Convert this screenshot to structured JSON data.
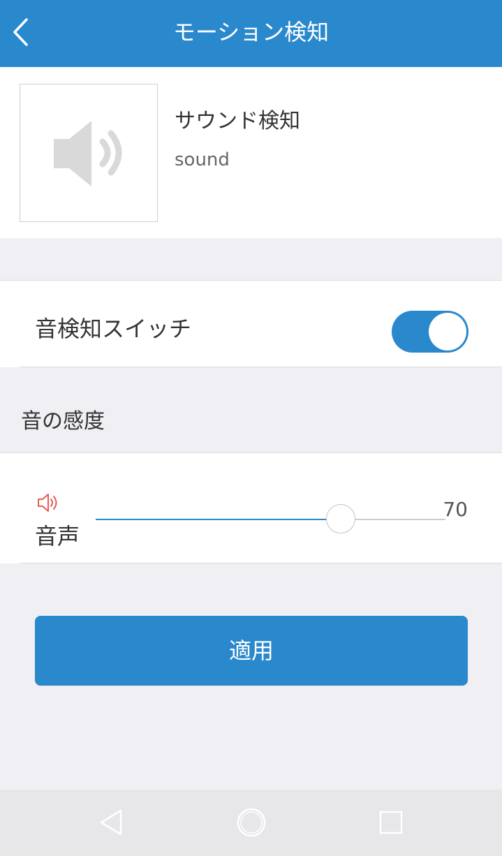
{
  "header": {
    "title": "モーション検知"
  },
  "info": {
    "title": "サウンド検知",
    "subtitle": "sound"
  },
  "switch_row": {
    "label": "音検知スイッチ",
    "enabled": true
  },
  "sensitivity": {
    "section_label": "音の感度",
    "slider_label": "音声",
    "value": "70",
    "max": 100
  },
  "apply_button": {
    "label": "適用"
  },
  "colors": {
    "accent": "#2a88cd",
    "background": "#efeff4",
    "volume_icon": "#e85b4f"
  },
  "icons": {
    "back": "chevron-left-icon",
    "speaker": "speaker-icon",
    "volume": "volume-icon",
    "nav_back": "triangle-back-icon",
    "nav_home": "circle-home-icon",
    "nav_recents": "square-recents-icon"
  }
}
